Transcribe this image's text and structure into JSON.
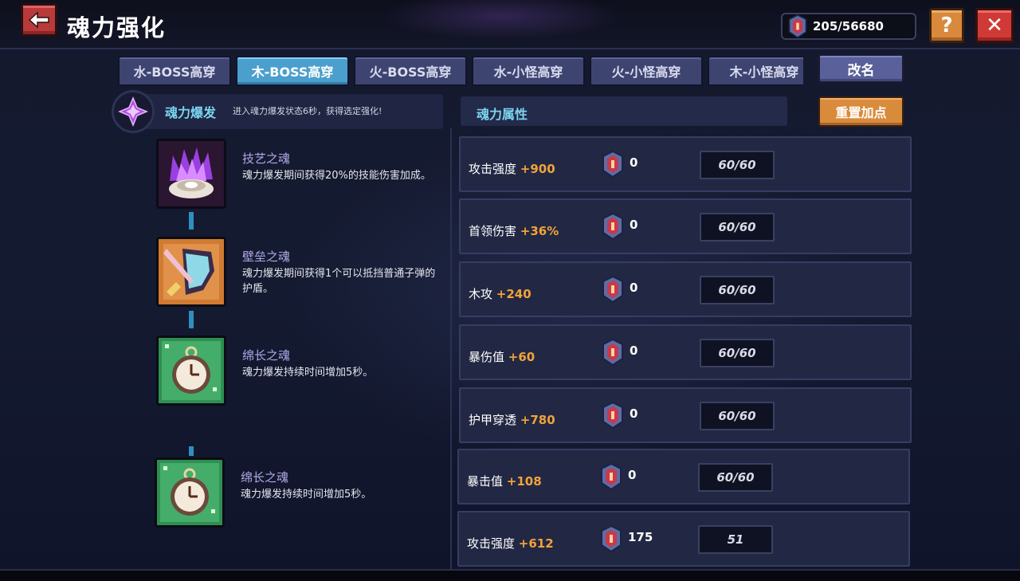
{
  "header": {
    "title": "魂力强化",
    "currency_value": "205/56680",
    "help_label": "?",
    "close_label": "✕",
    "back_label": "🡐"
  },
  "tabs": [
    {
      "label": "水-BOSS高穿",
      "active": false
    },
    {
      "label": "木-BOSS高穿",
      "active": true
    },
    {
      "label": "火-BOSS高穿",
      "active": false
    },
    {
      "label": "水-小怪高穿",
      "active": false
    },
    {
      "label": "火-小怪高穿",
      "active": false
    },
    {
      "label": "木-小怪高穿",
      "active": false
    }
  ],
  "rename_label": "改名",
  "burst": {
    "title": "魂力爆发",
    "description": "进入魂力爆发状态6秒，获得选定强化!"
  },
  "attributes_title": "魂力属性",
  "reset_label": "重置加点",
  "skills": [
    {
      "name": "技艺之魂",
      "desc": "魂力爆发期间获得20%的技能伤害加成。",
      "icon": "purple-flame-shell-icon"
    },
    {
      "name": "壁垒之魂",
      "desc": "魂力爆发期间获得1个可以抵挡普通子弹的护盾。",
      "icon": "shield-sword-icon"
    },
    {
      "name": "绵长之魂",
      "desc": "魂力爆发持续时间增加5秒。",
      "icon": "pocket-watch-icon"
    },
    {
      "name": "绵长之魂",
      "desc": "魂力爆发持续时间增加5秒。",
      "icon": "pocket-watch-icon"
    }
  ],
  "attributes": [
    {
      "label": "攻击强度",
      "bonus": "+900",
      "count": "0",
      "level": "60/60"
    },
    {
      "label": "首领伤害",
      "bonus": "+36%",
      "count": "0",
      "level": "60/60"
    },
    {
      "label": "木攻",
      "bonus": "+240",
      "count": "0",
      "level": "60/60"
    },
    {
      "label": "暴伤值",
      "bonus": "+60",
      "count": "0",
      "level": "60/60"
    },
    {
      "label": "护甲穿透",
      "bonus": "+780",
      "count": "0",
      "level": "60/60"
    },
    {
      "label": "暴击值",
      "bonus": "+108",
      "count": "0",
      "level": "60/60"
    },
    {
      "label": "攻击强度",
      "bonus": "+612",
      "count": "175",
      "level": "51"
    }
  ],
  "colors": {
    "accent_cyan": "#7bd4ee",
    "bonus_orange": "#f2a23a",
    "active_tab": "#4b9fcc"
  }
}
